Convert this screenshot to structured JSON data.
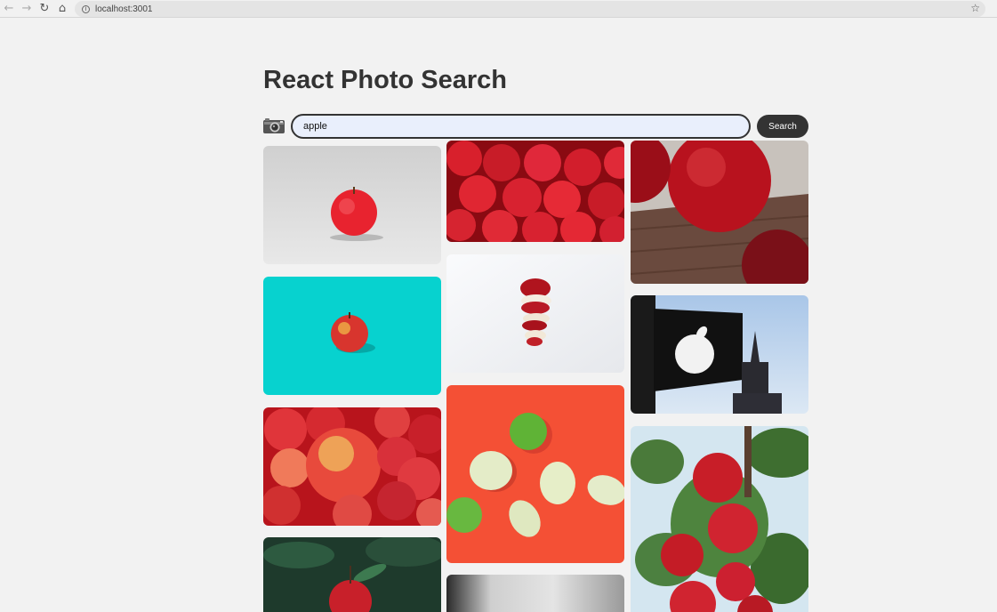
{
  "browser": {
    "url": "localhost:3001"
  },
  "app": {
    "title": "React Photo Search",
    "search": {
      "value": "apple",
      "button_label": "Search"
    }
  },
  "colors": {
    "page_background": "#f2f2f2",
    "text": "#333333",
    "button_background": "#333333",
    "input_background": "#e9effc"
  },
  "gallery": {
    "photos": [
      {
        "subject": "single red apple on grey background"
      },
      {
        "subject": "red apple on teal background"
      },
      {
        "subject": "pile of red and yellow apples"
      },
      {
        "subject": "apple on dark green foliage"
      },
      {
        "subject": "many red apples close up"
      },
      {
        "subject": "sliced red apple stacked"
      },
      {
        "subject": "green apples halves on orange background"
      },
      {
        "subject": "blurred grey image"
      },
      {
        "subject": "red apple on wooden table"
      },
      {
        "subject": "apple logo sign on building"
      },
      {
        "subject": "red apples on tree branch"
      }
    ]
  }
}
